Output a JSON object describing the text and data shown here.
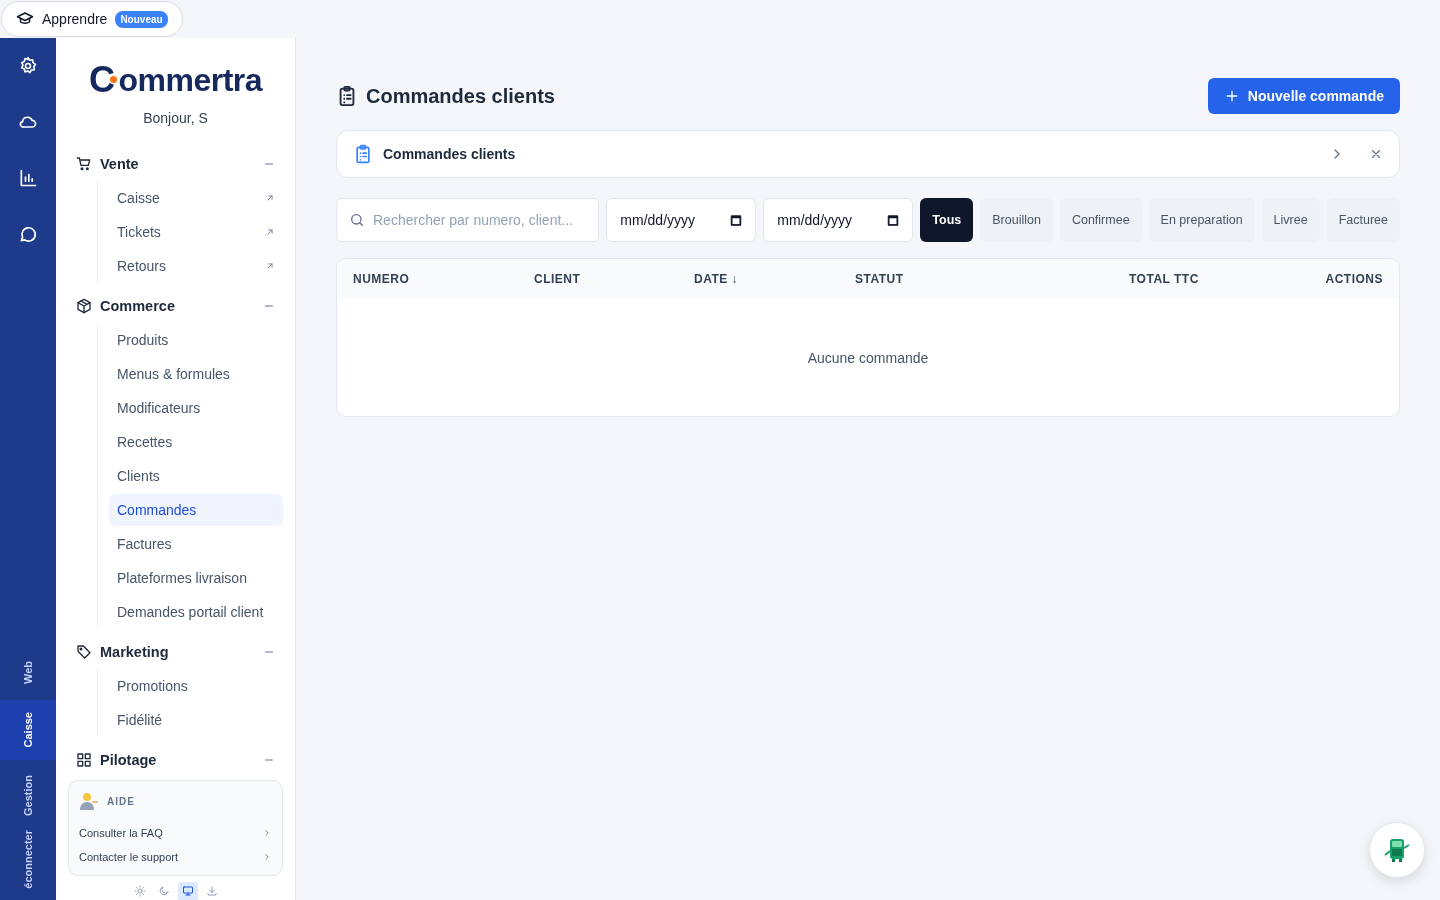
{
  "top_bar": {
    "learn_button": {
      "label": "Apprendre",
      "badge": "Nouveau"
    }
  },
  "rail": {
    "tabs": [
      {
        "label": "Web",
        "selected": false
      },
      {
        "label": "Caisse",
        "selected": true
      },
      {
        "label": "Gestion",
        "selected": false
      },
      {
        "label": "éconnecter",
        "selected": false
      }
    ]
  },
  "sidebar": {
    "logo": {
      "initial": "C",
      "rest": "ommertra"
    },
    "greeting": "Bonjour, S",
    "sections": [
      {
        "title": "Vente",
        "expanded": true,
        "items": [
          {
            "label": "Caisse",
            "external": true,
            "selected": false
          },
          {
            "label": "Tickets",
            "external": true,
            "selected": false
          },
          {
            "label": "Retours",
            "external": true,
            "selected": false
          }
        ]
      },
      {
        "title": "Commerce",
        "expanded": true,
        "items": [
          {
            "label": "Produits",
            "external": false,
            "selected": false
          },
          {
            "label": "Menus & formules",
            "external": false,
            "selected": false
          },
          {
            "label": "Modificateurs",
            "external": false,
            "selected": false
          },
          {
            "label": "Recettes",
            "external": false,
            "selected": false
          },
          {
            "label": "Clients",
            "external": false,
            "selected": false
          },
          {
            "label": "Commandes",
            "external": false,
            "selected": true
          },
          {
            "label": "Factures",
            "external": false,
            "selected": false
          },
          {
            "label": "Plateformes livraison",
            "external": false,
            "selected": false
          },
          {
            "label": "Demandes portail client",
            "external": false,
            "selected": false
          }
        ]
      },
      {
        "title": "Marketing",
        "expanded": true,
        "items": [
          {
            "label": "Promotions",
            "external": false,
            "selected": false
          },
          {
            "label": "Fidélité",
            "external": false,
            "selected": false
          }
        ]
      },
      {
        "title": "Pilotage",
        "expanded": true
      }
    ],
    "help": {
      "title": "AIDE",
      "links": [
        "Consulter la FAQ",
        "Contacter le support"
      ]
    },
    "theme_options": [
      {
        "kind": "light",
        "selected": false
      },
      {
        "kind": "dark",
        "selected": false
      },
      {
        "kind": "system",
        "selected": true
      },
      {
        "kind": "install",
        "selected": false
      }
    ]
  },
  "main": {
    "title": "Commandes clients",
    "new_button": "Nouvelle commande",
    "banner": {
      "title": "Commandes clients"
    },
    "search": {
      "placeholder": "Rechercher par numero, client..."
    },
    "date_from": {
      "placeholder": "mm/dd/yyyy"
    },
    "date_to": {
      "placeholder": "mm/dd/yyyy"
    },
    "status_filters": [
      {
        "label": "Tous",
        "selected": true
      },
      {
        "label": "Brouillon",
        "selected": false
      },
      {
        "label": "Confirmee",
        "selected": false
      },
      {
        "label": "En preparation",
        "selected": false
      },
      {
        "label": "Livree",
        "selected": false
      },
      {
        "label": "Facturee",
        "selected": false
      }
    ],
    "table": {
      "columns": [
        "NUMERO",
        "CLIENT",
        "DATE ↓",
        "STATUT",
        "TOTAL TTC",
        "ACTIONS"
      ],
      "empty_text": "Aucune commande"
    }
  }
}
